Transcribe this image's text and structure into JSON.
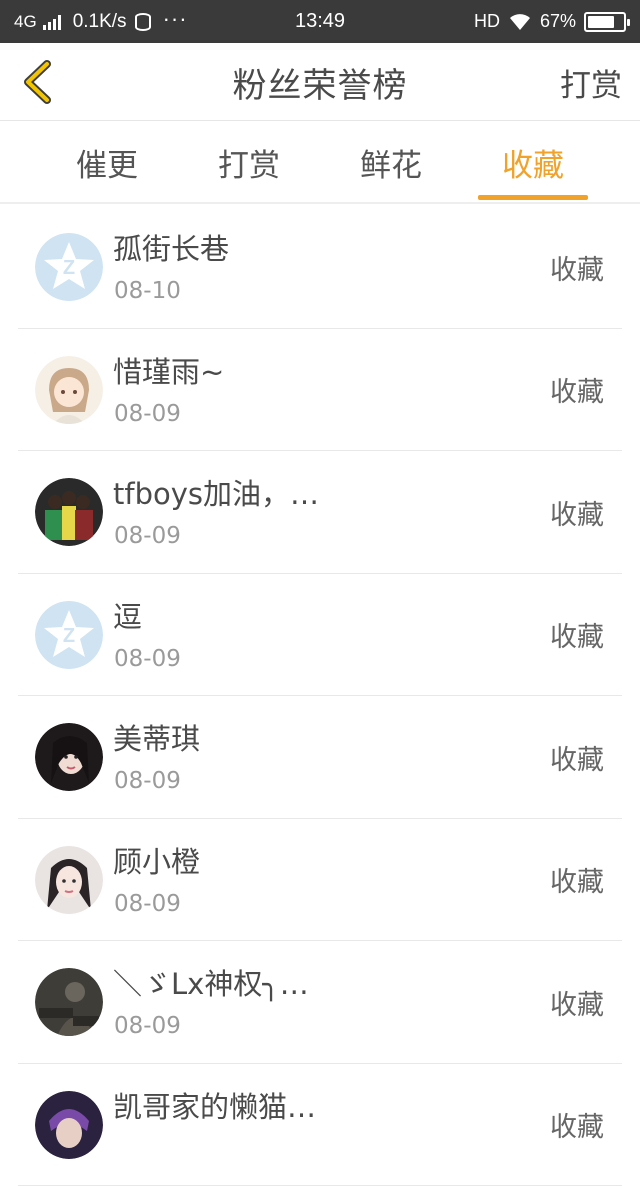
{
  "status_bar": {
    "network": "4G",
    "speed": "0.1K/s",
    "more": "···",
    "time": "13:49",
    "hd": "HD",
    "battery": "67%"
  },
  "header": {
    "title": "粉丝荣誉榜",
    "right_action": "打赏",
    "accent_color": "#f0a22a"
  },
  "tabs": [
    {
      "label": "催更",
      "active": false
    },
    {
      "label": "打赏",
      "active": false
    },
    {
      "label": "鲜花",
      "active": false
    },
    {
      "label": "收藏",
      "active": true
    }
  ],
  "fans": [
    {
      "name": "孤街长巷",
      "date": "08-10",
      "action": "收藏",
      "avatar": "qzone-default-avatar"
    },
    {
      "name": "惜瑾雨~",
      "date": "08-09",
      "action": "收藏",
      "avatar": "anime-girl-avatar"
    },
    {
      "name": "tfboys加油，…",
      "date": "08-09",
      "action": "收藏",
      "avatar": "group-photo-avatar"
    },
    {
      "name": "逗",
      "date": "08-09",
      "action": "收藏",
      "avatar": "qzone-default-avatar"
    },
    {
      "name": "美蒂琪",
      "date": "08-09",
      "action": "收藏",
      "avatar": "girl-photo-avatar"
    },
    {
      "name": "顾小橙",
      "date": "08-09",
      "action": "收藏",
      "avatar": "girl-photo-avatar"
    },
    {
      "name": "＼ゞLx神权╮…",
      "date": "08-09",
      "action": "收藏",
      "avatar": "dark-photo-avatar"
    },
    {
      "name": "凯哥家的懒猫…",
      "date": "",
      "action": "收藏",
      "avatar": "boy-photo-avatar"
    }
  ]
}
